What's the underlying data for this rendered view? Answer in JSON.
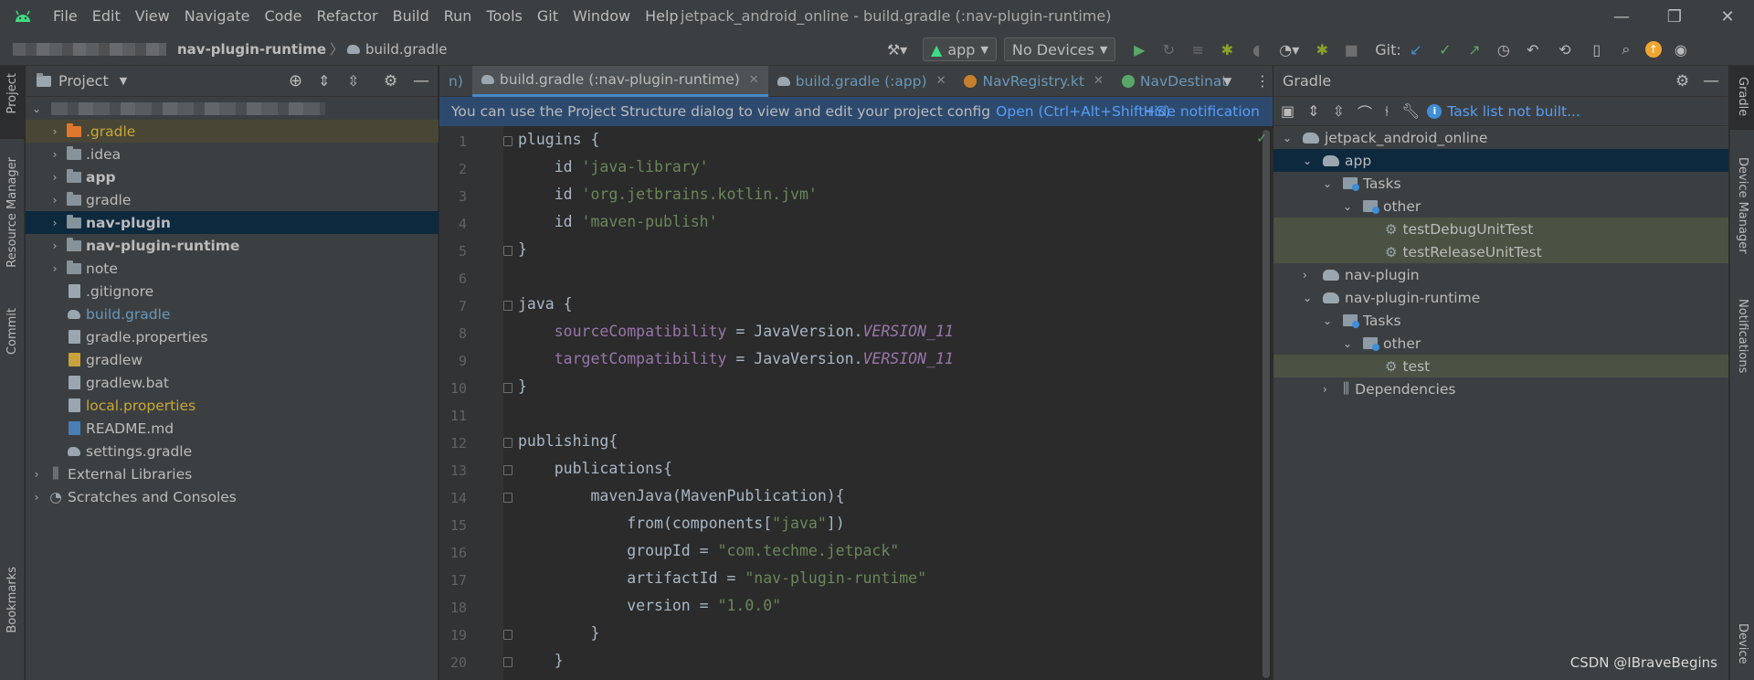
{
  "window": {
    "title": "jetpack_android_online - build.gradle (:nav-plugin-runtime)",
    "menu": [
      "File",
      "Edit",
      "View",
      "Navigate",
      "Code",
      "Refactor",
      "Build",
      "Run",
      "Tools",
      "Git",
      "Window",
      "Help"
    ]
  },
  "breadcrumb": {
    "module": "nav-plugin-runtime",
    "file": "build.gradle"
  },
  "toolbar": {
    "run_config": "app",
    "device": "No Devices",
    "git_label": "Git:"
  },
  "left_strip": {
    "project": "Project",
    "resource_manager": "Resource Manager",
    "commit": "Commit",
    "bookmarks": "Bookmarks"
  },
  "right_strip": {
    "gradle": "Gradle",
    "device_manager": "Device Manager",
    "notifications": "Notifications",
    "device": "Device"
  },
  "project_panel": {
    "title": "Project",
    "items": [
      {
        "label": ".gradle",
        "color": "#c7a838",
        "icon": "folder-orange-icon",
        "arrow": "›",
        "indent": 1
      },
      {
        "label": ".idea",
        "color": "#bbbbbb",
        "icon": "folder-icon",
        "arrow": "›",
        "indent": 1
      },
      {
        "label": "app",
        "color": "#bbbbbb",
        "icon": "module-folder-icon",
        "arrow": "›",
        "indent": 1,
        "bold": true
      },
      {
        "label": "gradle",
        "color": "#bbbbbb",
        "icon": "folder-icon",
        "arrow": "›",
        "indent": 1
      },
      {
        "label": "nav-plugin",
        "color": "#bbbbbb",
        "icon": "module-folder-icon",
        "arrow": "›",
        "indent": 1,
        "bold": true
      },
      {
        "label": "nav-plugin-runtime",
        "color": "#bbbbbb",
        "icon": "module-folder-icon",
        "arrow": "›",
        "indent": 1,
        "bold": true
      },
      {
        "label": "note",
        "color": "#bbbbbb",
        "icon": "folder-icon",
        "arrow": "›",
        "indent": 1
      },
      {
        "label": ".gitignore",
        "color": "#bbbbbb",
        "icon": "file-icon",
        "arrow": "",
        "indent": 1
      },
      {
        "label": "build.gradle",
        "color": "#6897bb",
        "icon": "gradle-file-icon",
        "arrow": "",
        "indent": 1
      },
      {
        "label": "gradle.properties",
        "color": "#bbbbbb",
        "icon": "properties-file-icon",
        "arrow": "",
        "indent": 1
      },
      {
        "label": "gradlew",
        "color": "#bbbbbb",
        "icon": "script-file-icon",
        "arrow": "",
        "indent": 1
      },
      {
        "label": "gradlew.bat",
        "color": "#bbbbbb",
        "icon": "file-icon",
        "arrow": "",
        "indent": 1
      },
      {
        "label": "local.properties",
        "color": "#c7a838",
        "icon": "properties-file-icon",
        "arrow": "",
        "indent": 1
      },
      {
        "label": "README.md",
        "color": "#bbbbbb",
        "icon": "markdown-file-icon",
        "arrow": "",
        "indent": 1
      },
      {
        "label": "settings.gradle",
        "color": "#bbbbbb",
        "icon": "gradle-file-icon",
        "arrow": "",
        "indent": 1
      },
      {
        "label": "External Libraries",
        "color": "#bbbbbb",
        "icon": "libraries-icon",
        "arrow": "›",
        "indent": 0
      },
      {
        "label": "Scratches and Consoles",
        "color": "#bbbbbb",
        "icon": "scratches-icon",
        "arrow": "›",
        "indent": 0
      }
    ]
  },
  "editor": {
    "tabs": [
      {
        "label": "n)",
        "active": false
      },
      {
        "label": "build.gradle (:nav-plugin-runtime)",
        "active": true
      },
      {
        "label": "build.gradle (:app)",
        "active": false
      },
      {
        "label": "NavRegistry.kt",
        "active": false
      },
      {
        "label": "NavDestinat",
        "active": false
      }
    ],
    "notification": {
      "text": "You can use the Project Structure dialog to view and edit your project config",
      "link": "Open (Ctrl+Alt+Shift+S)",
      "hide": "Hide notification"
    },
    "lines": [
      "1",
      "2",
      "3",
      "4",
      "5",
      "6",
      "7",
      "8",
      "9",
      "10",
      "11",
      "12",
      "13",
      "14",
      "15",
      "16",
      "17",
      "18",
      "19",
      "20"
    ],
    "code": {
      "l1": "plugins {",
      "l2a": "    id ",
      "l2b": "'java-library'",
      "l3a": "    id ",
      "l3b": "'org.jetbrains.kotlin.jvm'",
      "l4a": "    id ",
      "l4b": "'maven-publish'",
      "l5": "}",
      "l7": "java {",
      "l8a": "    sourceCompatibility",
      "l8b": " = JavaVersion.",
      "l8c": "VERSION_11",
      "l9a": "    targetCompatibility",
      "l9b": " = JavaVersion.",
      "l9c": "VERSION_11",
      "l10": "}",
      "l12": "publishing{",
      "l13": "    publications{",
      "l14": "        mavenJava(MavenPublication){",
      "l15a": "            from(components[",
      "l15b": "\"java\"",
      "l15c": "])",
      "l16a": "            groupId = ",
      "l16b": "\"com.techme.jetpack\"",
      "l17a": "            artifactId = ",
      "l17b": "\"nav-plugin-runtime\"",
      "l18a": "            version = ",
      "l18b": "\"1.0.0\"",
      "l19": "        }",
      "l20": "    }"
    }
  },
  "gradle_panel": {
    "title": "Gradle",
    "task_status": "Task list not built...",
    "tree": {
      "root": "jetpack_android_online",
      "app": "app",
      "tasks1": "Tasks",
      "other1": "other",
      "t1": "testDebugUnitTest",
      "t2": "testReleaseUnitTest",
      "navplugin": "nav-plugin",
      "navruntime": "nav-plugin-runtime",
      "tasks2": "Tasks",
      "other2": "other",
      "t3": "test",
      "deps": "Dependencies"
    }
  },
  "watermark": "CSDN @IBraveBegins"
}
